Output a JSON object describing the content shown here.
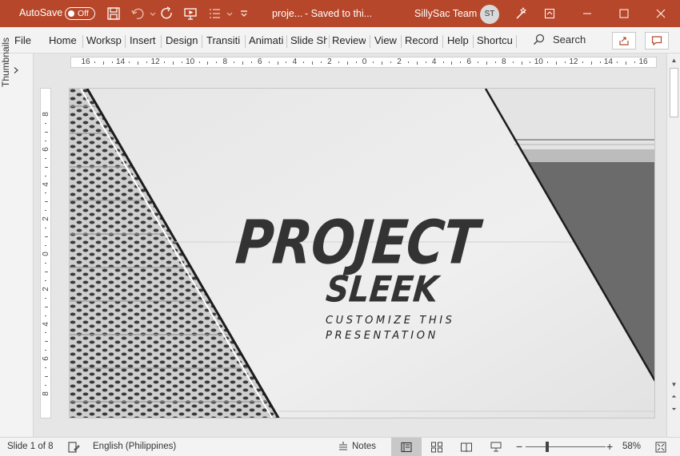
{
  "titlebar": {
    "autosave_label": "AutoSave",
    "autosave_state": "Off",
    "filename": "proje...",
    "saved_status": "-  Saved to thi...",
    "user_name": "SillySac Team",
    "user_initials": "ST"
  },
  "menu": {
    "items": [
      "File",
      "Home",
      "Worksp",
      "Insert",
      "Design",
      "Transiti",
      "Animati",
      "Slide Sh",
      "Review",
      "View",
      "Record",
      "Help",
      "Shortcu"
    ],
    "search_label": "Search"
  },
  "thumbnails": {
    "label": "Thumbnails"
  },
  "hruler": {
    "labels": [
      "16",
      "14",
      "12",
      "10",
      "8",
      "6",
      "4",
      "2",
      "0",
      "2",
      "4",
      "6",
      "8",
      "10",
      "12",
      "14",
      "16"
    ]
  },
  "vruler": {
    "labels": [
      "8",
      "6",
      "4",
      "2",
      "0",
      "2",
      "4",
      "6",
      "8"
    ]
  },
  "slide": {
    "title": "PROJECT",
    "subtitle": "SLEEK",
    "tagline_line1": "CUSTOMIZE THIS",
    "tagline_line2": "PRESENTATION"
  },
  "status": {
    "slide_info": "Slide 1 of 8",
    "language": "English (Philippines)",
    "notes_label": "Notes",
    "zoom_percent": "58%"
  },
  "colors": {
    "accent": "#b7472a"
  }
}
